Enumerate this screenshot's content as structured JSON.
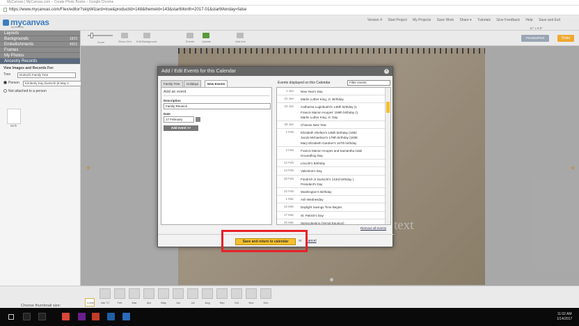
{
  "browser": {
    "window_title": "MyCanvas | MyCanvas.com – Create Photo Books – Google Chrome",
    "url": "https://www.mycanvas.com/Flex/editor?skipWizard=true&productId=148&themeId=143&startMonth=2017-01&startMonday=false"
  },
  "app": {
    "logo": "mycanvas",
    "logo_sub": "by ancestry",
    "top_nav": [
      "Version 4",
      "Start Project",
      "My Projects",
      "Save Work",
      "Share ▾",
      "Tutorials",
      "Give Feedback",
      "Help",
      "Save and Exit"
    ]
  },
  "sidebar": {
    "sections": [
      {
        "label": "Layouts",
        "count": ""
      },
      {
        "label": "Backgrounds",
        "count": "1823"
      },
      {
        "label": "Embellishments",
        "count": "4653"
      },
      {
        "label": "Frames",
        "count": ""
      },
      {
        "label": "My Photos",
        "count": ""
      },
      {
        "label": "Ancestry Records",
        "count": ""
      }
    ],
    "view_label": "View Images and Records For:",
    "tree_label": "Tree",
    "tree_value": "Durtschi Family Tree",
    "person_label": "Person",
    "person_value": "Kimberly Kay Durtschi (8 May 1",
    "not_attached": "Not attached to a person",
    "birth_label": "Birth"
  },
  "toolbar": {
    "zoom": "Zoom",
    "show_grid": "Show Grid",
    "edit_background": "Edit Background",
    "events": "Events",
    "update": "Update",
    "add_text": "Add text",
    "preview": "Preview/Print",
    "order": "Order",
    "size": "11\" x 8.5\""
  },
  "canvas": {
    "page_text": "text"
  },
  "modal": {
    "title": "Add / Edit Events for this Calendar",
    "close": "×",
    "tabs": [
      "Family Tree",
      "Holidays",
      "New Events"
    ],
    "add_event_title": "Add an event",
    "description_label": "Description",
    "description_value": "Family Reunion",
    "date_label": "Date",
    "date_value": "17 February",
    "add_button": "Add event >>",
    "events_label": "Events displayed on this Calendar",
    "filter": "Filter events",
    "events": [
      {
        "date": "1 Jan",
        "names": [
          "New Year's Day"
        ]
      },
      {
        "date": "15 Jan",
        "names": [
          "Martin Luther King, Jr. Birthday"
        ]
      },
      {
        "date": "16 Jan",
        "names": [
          "Catharina Luginbuehl's 145th birthday (1",
          "Francis Marion Hoopes' 159th birthday (1",
          "Martin Luther King, Jr. Day"
        ]
      },
      {
        "date": "28 Jan",
        "names": [
          "Chinese New Year"
        ]
      },
      {
        "date": "1 Feb",
        "names": [
          "Elizabeth Shelton's 135th birthday (1882",
          "Jacob Michaelson's 179th birthday (1838",
          "Mary Elizabeth Gardner's 167th birthday"
        ]
      },
      {
        "date": "2 Feb",
        "names": [
          "Francis Marion Hoopes and Samantha Adali",
          "Groundhog Day"
        ]
      },
      {
        "date": "12 Feb",
        "names": [
          "Lincoln's Birthday"
        ]
      },
      {
        "date": "14 Feb",
        "names": [
          "Valentine's Day"
        ]
      },
      {
        "date": "20 Feb",
        "names": [
          "Friedrich Jr Durtschi's 143rd birthday (",
          "President's Day"
        ]
      },
      {
        "date": "22 Feb",
        "names": [
          "Washington's Birthday"
        ]
      },
      {
        "date": "1 Mar",
        "names": [
          "Ash Wednesday"
        ]
      },
      {
        "date": "12 Mar",
        "names": [
          "Daylight Savings Time Begins"
        ]
      },
      {
        "date": "17 Mar",
        "names": [
          "St. Patrick's Day"
        ]
      },
      {
        "date": "20 Mar",
        "names": [
          "Spring Begins (Vernal Equinox)"
        ]
      }
    ],
    "remove_all": "Remove all events",
    "save_button": "Save and return to calendar",
    "or": "or",
    "cancel": "Cancel"
  },
  "thumbnails": {
    "label": "Choose thumbnail size:",
    "pages": [
      "Cover",
      "Jan '17",
      "Feb",
      "Mar",
      "Apr",
      "May",
      "Jun",
      "Jul",
      "Aug",
      "Sep",
      "Oct",
      "Nov",
      "Dec"
    ]
  },
  "taskbar": {
    "time": "11:02 AM",
    "date": "1/14/2017"
  },
  "colors": {
    "accent": "#f5c02c",
    "highlight": "#e8212a",
    "brand": "#3b7dbf"
  }
}
